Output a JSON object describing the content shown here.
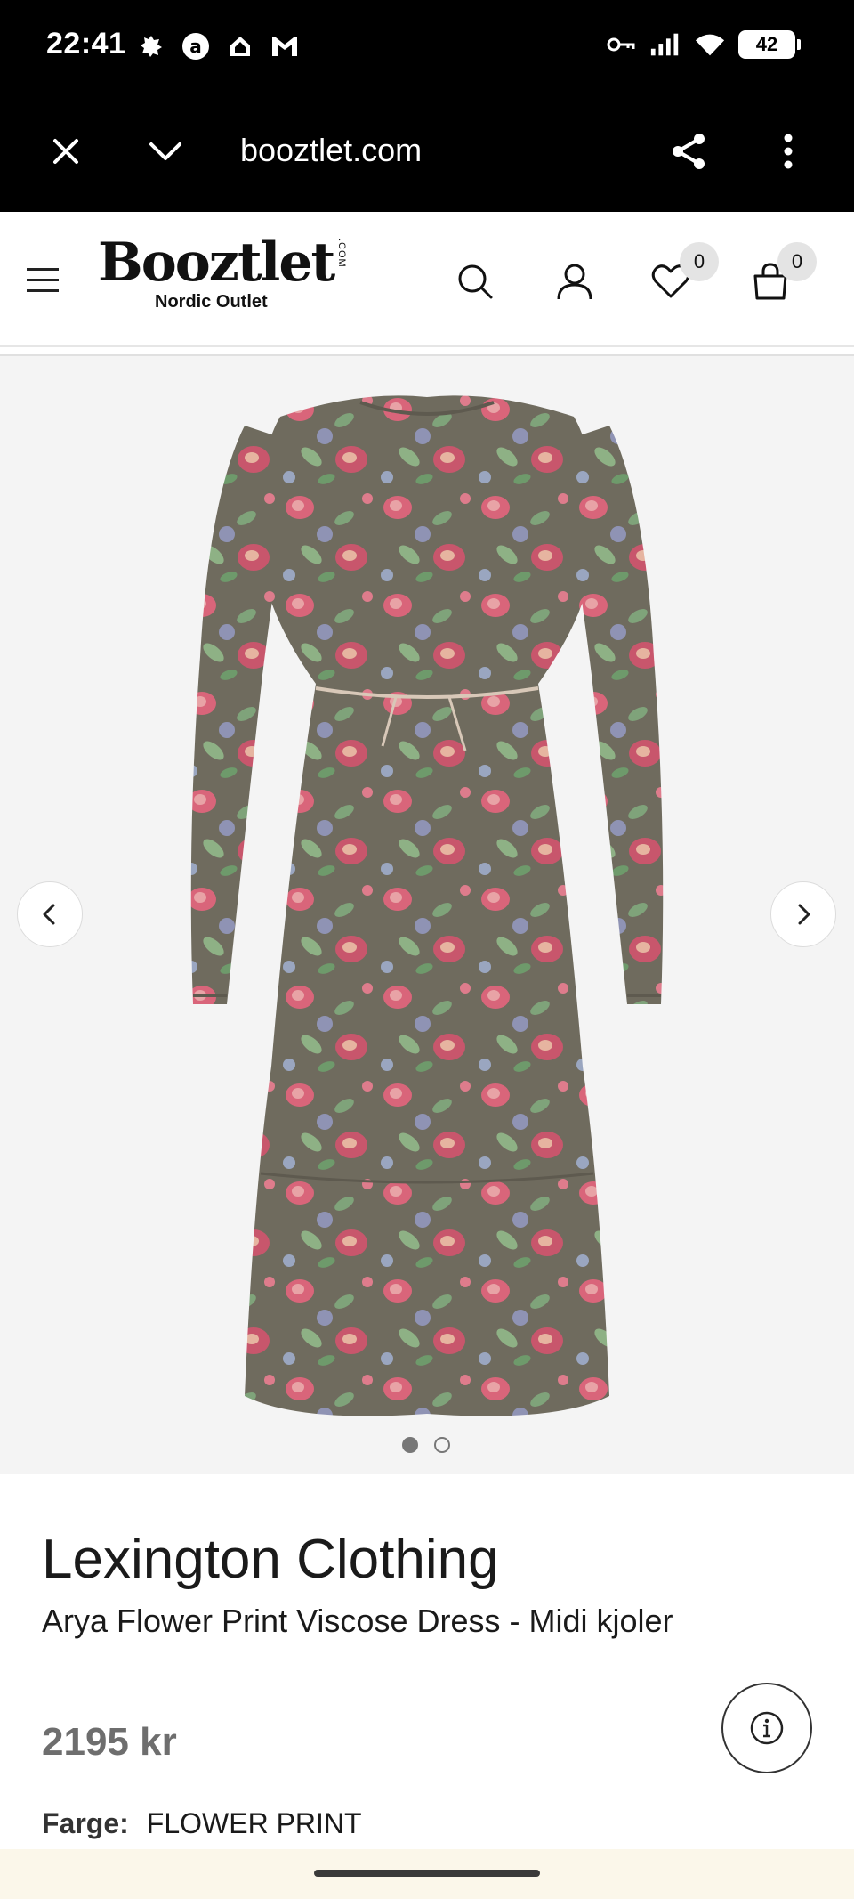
{
  "status_bar": {
    "time": "22:41",
    "battery": "42",
    "left_icons": [
      "gear-notification-icon",
      "app-notification-icon",
      "home-notification-icon",
      "gmail-icon"
    ],
    "right_icons": [
      "key-icon",
      "signal-icon",
      "wifi-icon",
      "battery-icon"
    ]
  },
  "browser": {
    "url": "booztlet.com",
    "buttons": [
      "close-icon",
      "chevron-down-icon",
      "share-icon",
      "more-vert-icon"
    ]
  },
  "site_header": {
    "logo_main": "Booztlet",
    "logo_com": ".COM",
    "logo_sub": "Nordic Outlet",
    "wishlist_count": "0",
    "cart_count": "0",
    "icons": [
      "menu-icon",
      "search-icon",
      "account-icon",
      "heart-icon",
      "bag-icon"
    ]
  },
  "carousel": {
    "slides": 2,
    "active_slide": 1,
    "prev_icon": "chevron-left-icon",
    "next_icon": "chevron-right-icon",
    "colors": {
      "background": "#f4f4f4",
      "dress_base": "#6f6b5e",
      "flower_pink": "#d9657a",
      "flower_green": "#7fa37a"
    }
  },
  "product": {
    "brand": "Lexington Clothing",
    "name": "Arya Flower Print Viscose Dress - Midi kjoler",
    "price": "2195 kr",
    "color_label": "Farge:",
    "color_value": "FLOWER PRINT"
  }
}
